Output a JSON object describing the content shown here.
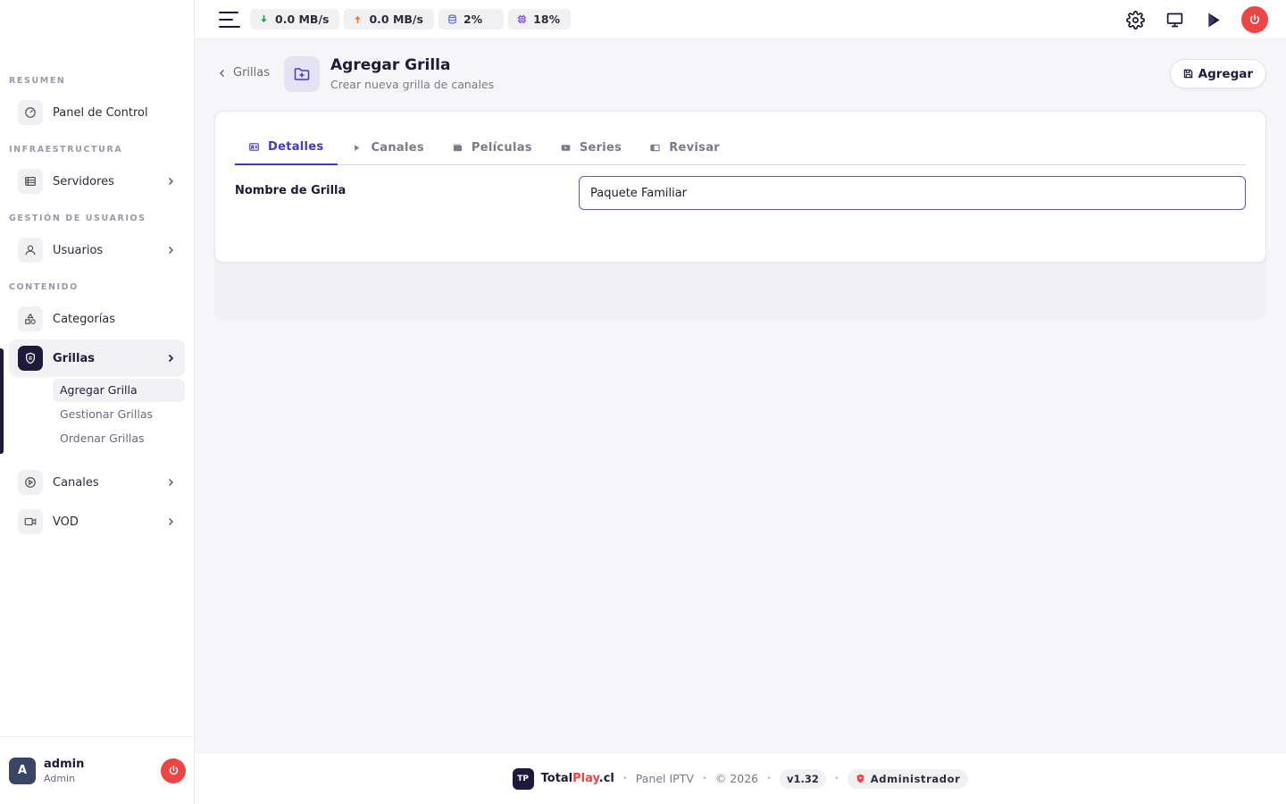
{
  "sidebar": {
    "sections": {
      "resumen": "RESUMEN",
      "infra": "INFRAESTRUCTURA",
      "usuarios": "GESTIÓN DE USUARIOS",
      "contenido": "CONTENIDO"
    },
    "items": {
      "panel": "Panel de Control",
      "servidores": "Servidores",
      "usuarios": "Usuarios",
      "categorias": "Categorías",
      "grillas": "Grillas",
      "canales": "Canales",
      "vod": "VOD"
    },
    "grillas_sub": [
      "Agregar Grilla",
      "Gestionar Grillas",
      "Ordenar Grillas"
    ],
    "user": {
      "initial": "A",
      "name": "admin",
      "role": "Admin"
    }
  },
  "topbar": {
    "download": "0.0 MB/s",
    "upload": "0.0 MB/s",
    "storage": "2%",
    "cpu": "18%"
  },
  "header": {
    "back_label": "Grillas",
    "title": "Agregar Grilla",
    "subtitle": "Crear nueva grilla de canales",
    "add_label": "Agregar"
  },
  "tabs": [
    "Detalles",
    "Canales",
    "Películas",
    "Series",
    "Revisar"
  ],
  "form": {
    "name_label": "Nombre de Grilla",
    "name_value": "Paquete Familiar"
  },
  "footer": {
    "logo": "TP",
    "brand_a": "Total",
    "brand_b": "Play",
    "brand_c": ".cl",
    "panel": "Panel IPTV",
    "copyright": "© 2026",
    "version": "v1.32",
    "role": "Administrador"
  },
  "colors": {
    "accent": "#4338ca",
    "dark": "#1e1b3a",
    "danger": "#ef4444"
  }
}
